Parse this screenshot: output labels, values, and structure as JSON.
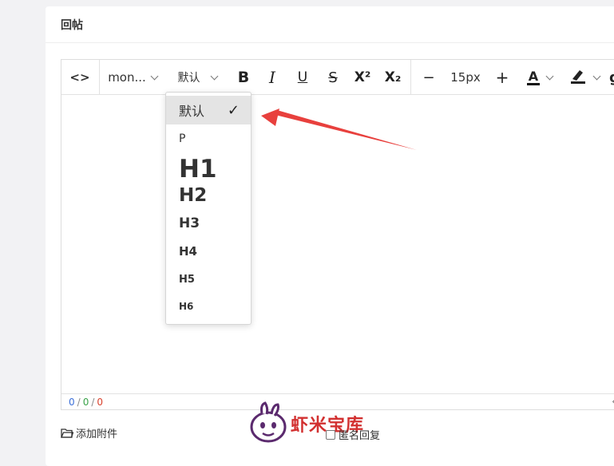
{
  "card": {
    "title": "回帖"
  },
  "toolbar": {
    "code_label": "<>",
    "font_family": "mon...",
    "heading": "默认",
    "bold": "B",
    "italic": "I",
    "underline": "U",
    "strike": "S",
    "superscript": "X²",
    "subscript": "X₂",
    "minus": "−",
    "font_size": "15px",
    "plus": "+",
    "font_color_label": "A",
    "colors": {
      "font_color": "#111111",
      "accent_arrow": "#e8403d"
    }
  },
  "dropdown": {
    "items": [
      {
        "label": "默认",
        "selected": true
      },
      {
        "label": "P"
      },
      {
        "label": "H1"
      },
      {
        "label": "H2"
      },
      {
        "label": "H3"
      },
      {
        "label": "H4"
      },
      {
        "label": "H5"
      },
      {
        "label": "H6"
      }
    ],
    "check": "✓"
  },
  "status": {
    "a": "0",
    "b": "0",
    "c": "0",
    "sep": "/"
  },
  "footer": {
    "attach_label": "添加附件",
    "anon_label": "匿名回复"
  },
  "watermark": {
    "text": "虾米宝库"
  }
}
